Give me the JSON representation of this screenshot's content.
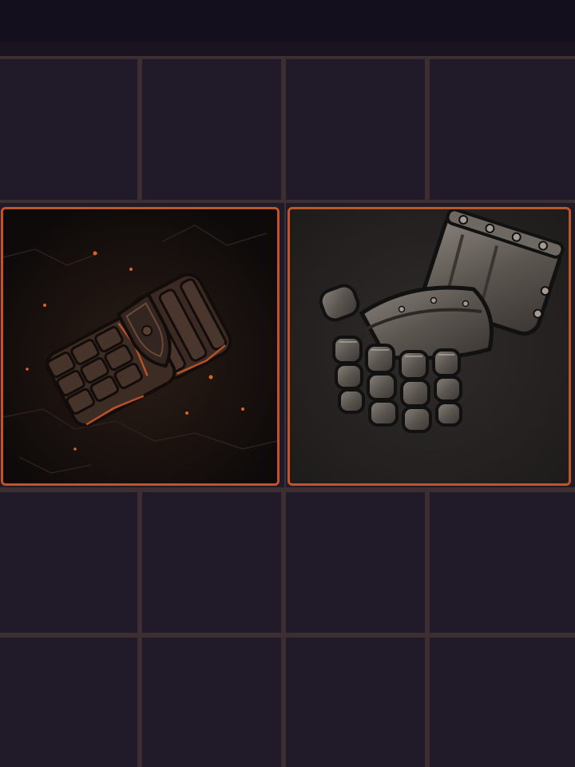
{
  "screen": "inventory",
  "accent_color": "#c2542a",
  "grid": {
    "rows": 5,
    "columns": 4
  },
  "items": [
    {
      "name": "gauntlet-icon",
      "description_icon": "ember-stone-gauntlet",
      "row": 2,
      "column": 1,
      "span_columns": 2,
      "span_rows": 2,
      "highlighted": true
    },
    {
      "name": "gauntlet-icon",
      "description_icon": "iron-plate-gauntlet",
      "row": 2,
      "column": 3,
      "span_columns": 2,
      "span_rows": 2,
      "highlighted": true
    }
  ]
}
